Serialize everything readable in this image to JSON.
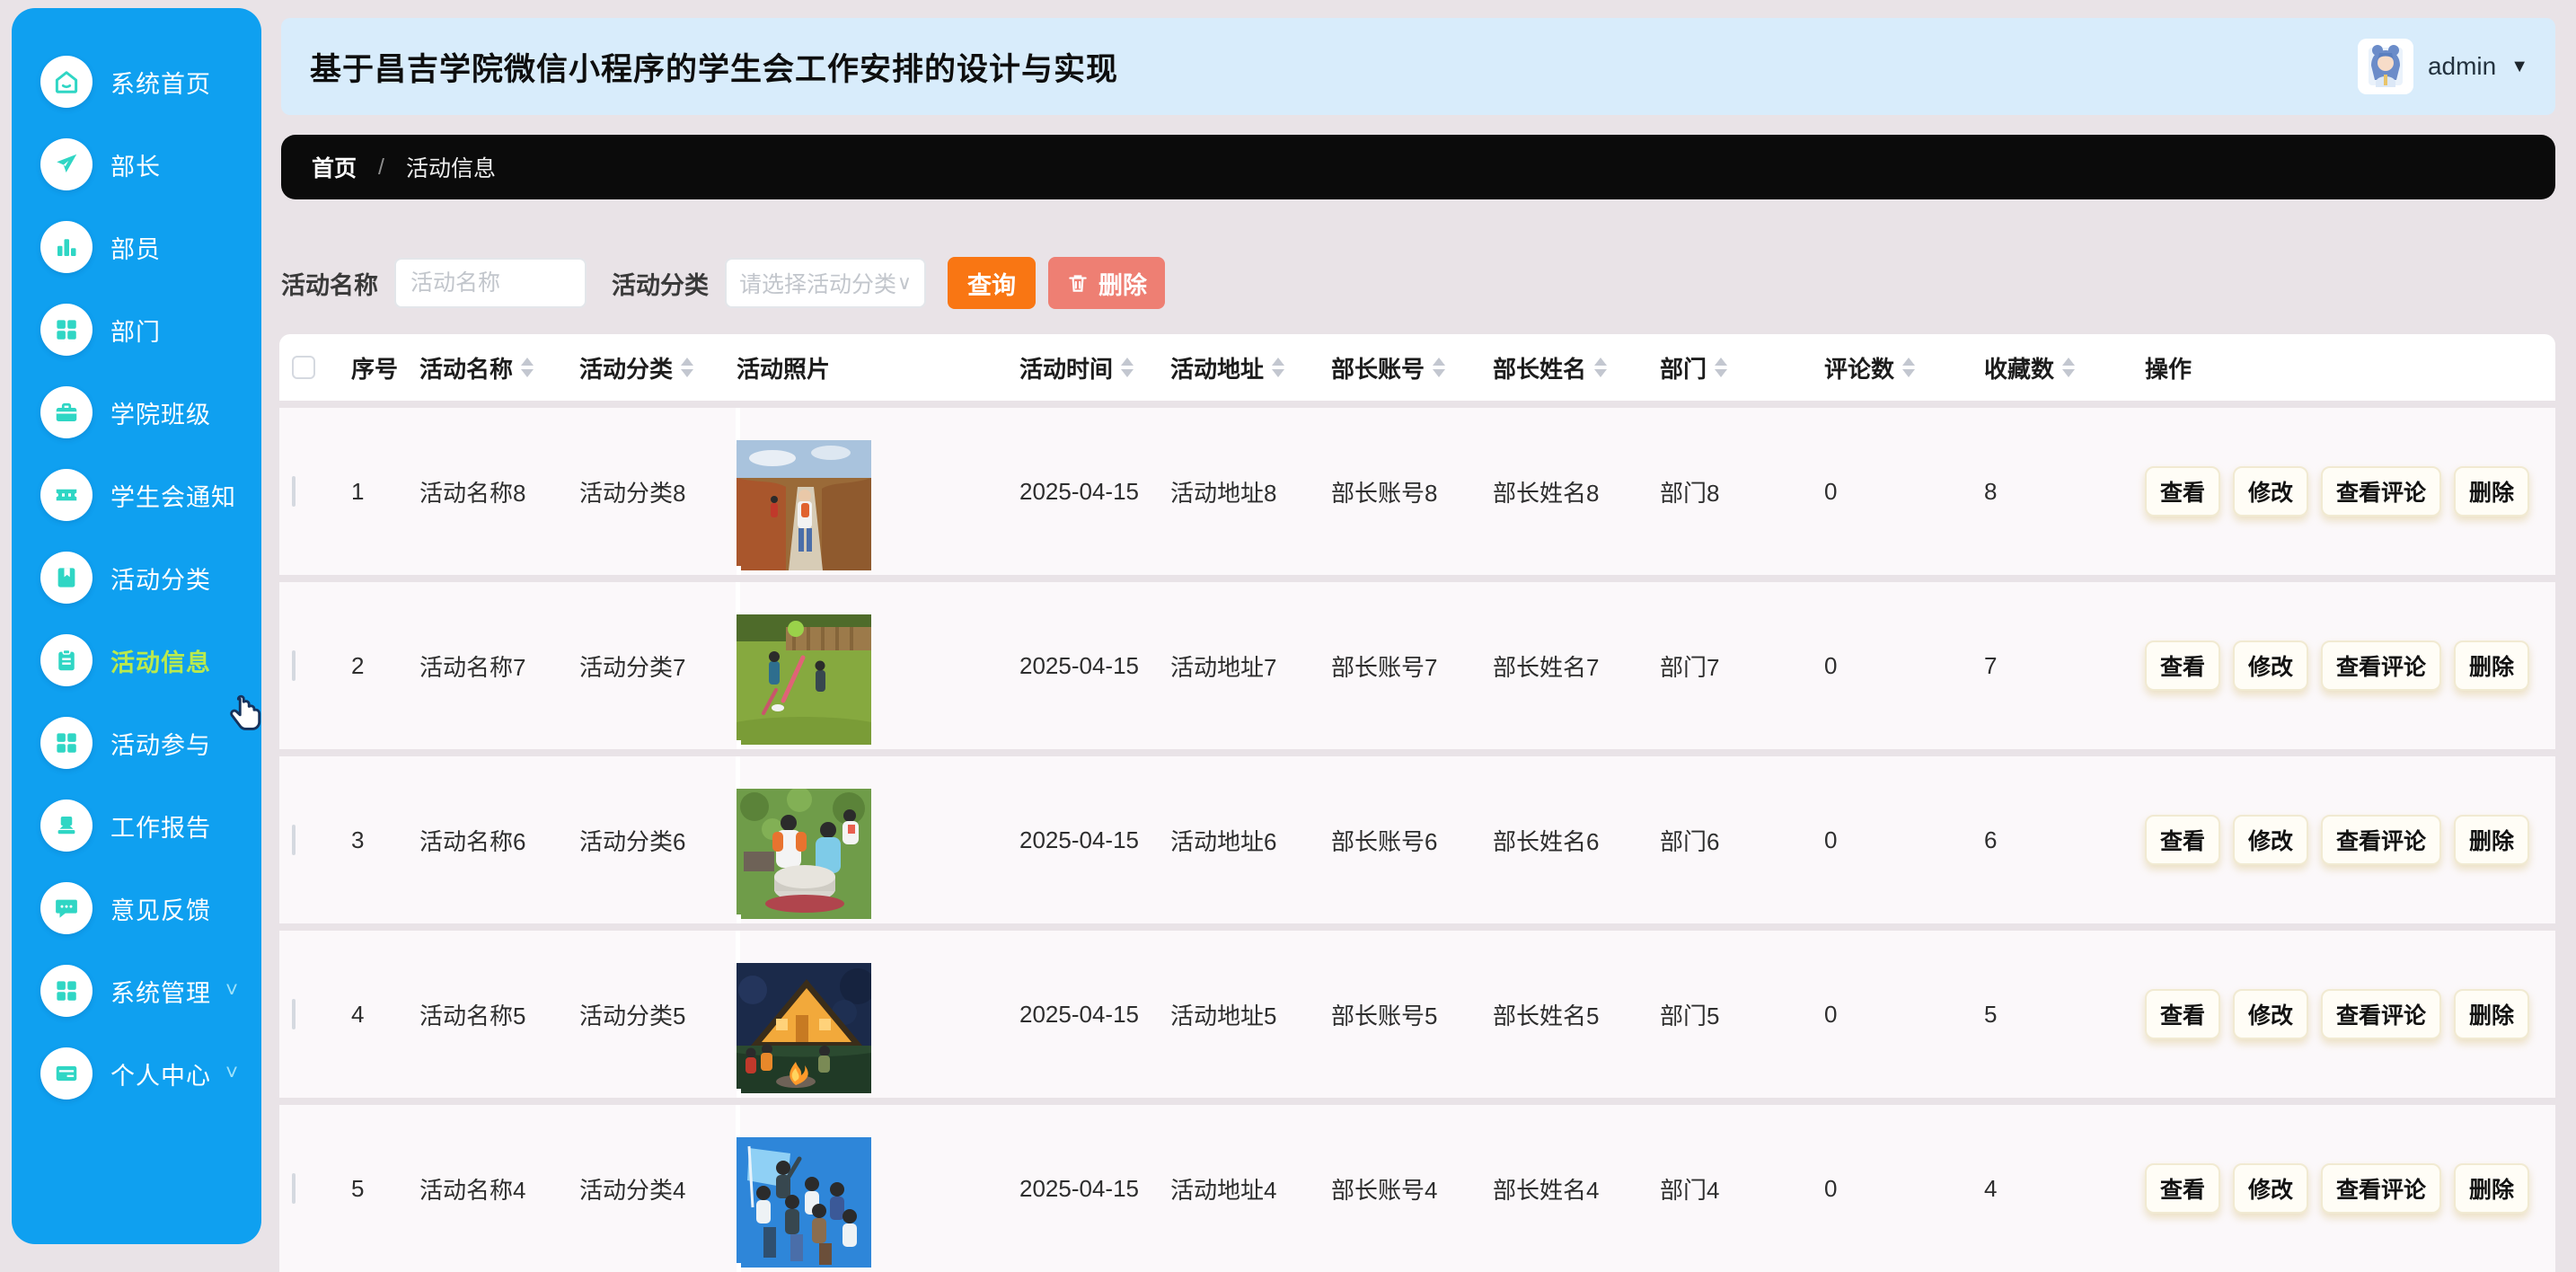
{
  "header": {
    "title": "基于昌吉学院微信小程序的学生会工作安排的设计与实现",
    "user": "admin"
  },
  "breadcrumb": {
    "home": "首页",
    "separator": "/",
    "current": "活动信息"
  },
  "sidebar": {
    "bg_color": "#0fa0f0",
    "active_color": "#b9ea4d",
    "icon_color": "#2fd6c4",
    "items": [
      {
        "label": "系统首页",
        "icon": "home-icon",
        "active": false,
        "chevron": false
      },
      {
        "label": "部长",
        "icon": "send-icon",
        "active": false,
        "chevron": false
      },
      {
        "label": "部员",
        "icon": "bar-chart-icon",
        "active": false,
        "chevron": false
      },
      {
        "label": "部门",
        "icon": "grid-icon",
        "active": false,
        "chevron": false
      },
      {
        "label": "学院班级",
        "icon": "briefcase-icon",
        "active": false,
        "chevron": false
      },
      {
        "label": "学生会通知",
        "icon": "ticket-icon",
        "active": false,
        "chevron": false
      },
      {
        "label": "活动分类",
        "icon": "book-icon",
        "active": false,
        "chevron": false
      },
      {
        "label": "活动信息",
        "icon": "clipboard-icon",
        "active": true,
        "chevron": false
      },
      {
        "label": "活动参与",
        "icon": "grid-icon",
        "active": false,
        "chevron": false
      },
      {
        "label": "工作报告",
        "icon": "stamp-icon",
        "active": false,
        "chevron": false
      },
      {
        "label": "意见反馈",
        "icon": "chat-icon",
        "active": false,
        "chevron": false
      },
      {
        "label": "系统管理",
        "icon": "grid-icon",
        "active": false,
        "chevron": true
      },
      {
        "label": "个人中心",
        "icon": "id-card-icon",
        "active": false,
        "chevron": true
      }
    ],
    "chevron_glyph": "˅"
  },
  "filters": {
    "name_label": "活动名称",
    "name_placeholder": "活动名称",
    "category_label": "活动分类",
    "category_placeholder": "请选择活动分类",
    "select_caret": "∨",
    "search_button": "查询",
    "delete_button": "删除"
  },
  "table": {
    "columns": [
      {
        "label": "序号",
        "sortable": false
      },
      {
        "label": "活动名称",
        "sortable": true
      },
      {
        "label": "活动分类",
        "sortable": true
      },
      {
        "label": "活动照片",
        "sortable": false
      },
      {
        "label": "活动时间",
        "sortable": true
      },
      {
        "label": "活动地址",
        "sortable": true
      },
      {
        "label": "部长账号",
        "sortable": true
      },
      {
        "label": "部长姓名",
        "sortable": true
      },
      {
        "label": "部门",
        "sortable": true
      },
      {
        "label": "评论数",
        "sortable": true
      },
      {
        "label": "收藏数",
        "sortable": true
      },
      {
        "label": "操作",
        "sortable": false
      }
    ],
    "actions": {
      "view": "查看",
      "edit": "修改",
      "view_comments": "查看评论",
      "delete": "删除"
    },
    "rows": [
      {
        "index": "1",
        "name": "活动名称8",
        "category": "活动分类8",
        "photo": "autumn-trail-group-hike",
        "time": "2025-04-15",
        "address": "活动地址8",
        "leader_account": "部长账号8",
        "leader_name": "部长姓名8",
        "department": "部门8",
        "comments": "0",
        "favorites": "8"
      },
      {
        "index": "2",
        "name": "活动名称7",
        "category": "活动分类7",
        "photo": "backyard-games-on-lawn",
        "time": "2025-04-15",
        "address": "活动地址7",
        "leader_account": "部长账号7",
        "leader_name": "部长姓名7",
        "department": "部门7",
        "comments": "0",
        "favorites": "7"
      },
      {
        "index": "3",
        "name": "活动名称6",
        "category": "活动分类6",
        "photo": "kids-stone-mill-in-forest",
        "time": "2025-04-15",
        "address": "活动地址6",
        "leader_account": "部长账号6",
        "leader_name": "部长姓名6",
        "department": "部门6",
        "comments": "0",
        "favorites": "6"
      },
      {
        "index": "4",
        "name": "活动名称5",
        "category": "活动分类5",
        "photo": "cabin-campfire-at-dusk",
        "time": "2025-04-15",
        "address": "活动地址5",
        "leader_account": "部长账号5",
        "leader_name": "部长姓名5",
        "department": "部门5",
        "comments": "0",
        "favorites": "5"
      },
      {
        "index": "5",
        "name": "活动名称4",
        "category": "活动分类4",
        "photo": "group-cheering-with-blue-flag",
        "time": "2025-04-15",
        "address": "活动地址4",
        "leader_account": "部长账号4",
        "leader_name": "部长姓名4",
        "department": "部门4",
        "comments": "0",
        "favorites": "4"
      }
    ]
  }
}
